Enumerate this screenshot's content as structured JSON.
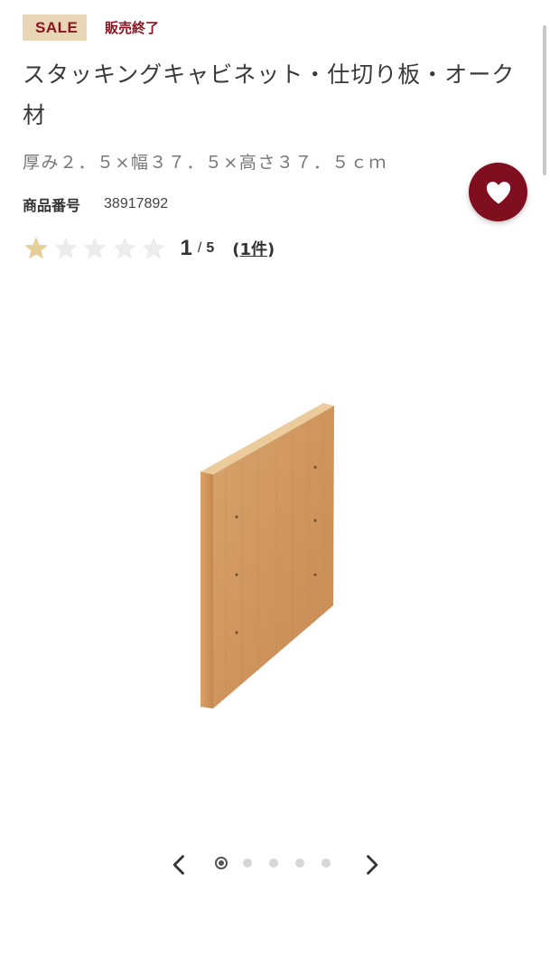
{
  "header": {
    "sale_badge": "SALE",
    "status": "販売終了"
  },
  "product": {
    "title": "スタッキングキャビネット・仕切り板・オーク材",
    "spec": "厚み２．５×幅３７．５×高さ３７．５ｃｍ",
    "number_label": "商品番号",
    "number_value": "38917892"
  },
  "rating": {
    "value": "1",
    "separator": "/",
    "max": "5",
    "stars_filled": 1,
    "stars_total": 5,
    "review_count_prefix": "(",
    "review_count": "1件",
    "review_count_suffix": ")"
  },
  "favorite": {
    "icon": "heart-icon"
  },
  "image": {
    "alt": "スタッキングキャビネット・仕切り板・オーク材"
  },
  "carousel": {
    "total": 5,
    "active_index": 0,
    "prev_icon": "chevron-left-icon",
    "next_icon": "chevron-right-icon"
  },
  "colors": {
    "accent": "#7f0f1e",
    "sale_bg": "#e8d6b6",
    "star_filled": "#e6cf9a",
    "star_empty": "#ececec"
  }
}
